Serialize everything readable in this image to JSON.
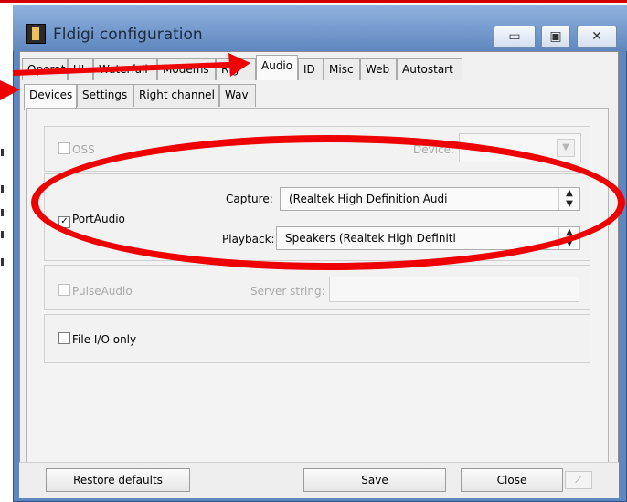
{
  "window": {
    "title": "Fldigi configuration",
    "controls": {
      "minimize": "▭",
      "maximize": "▣",
      "close": "✕"
    }
  },
  "tabs_top": [
    {
      "label": "Operator"
    },
    {
      "label": "UI"
    },
    {
      "label": "Waterfall"
    },
    {
      "label": "Modems"
    },
    {
      "label": "Rig"
    },
    {
      "label": "Audio",
      "active": true
    },
    {
      "label": "ID"
    },
    {
      "label": "Misc"
    },
    {
      "label": "Web"
    },
    {
      "label": "Autostart"
    }
  ],
  "tabs_sub": [
    {
      "label": "Devices",
      "active": true
    },
    {
      "label": "Settings"
    },
    {
      "label": "Right channel"
    },
    {
      "label": "Wav"
    }
  ],
  "oss": {
    "label": "OSS",
    "device_label": "Device:",
    "checked": false,
    "enabled": false
  },
  "portaudio": {
    "label": "PortAudio",
    "checked": true,
    "check_glyph": "✓",
    "capture_label": "Capture:",
    "capture_value": "(Realtek High Definition Audi",
    "playback_label": "Playback:",
    "playback_value": "Speakers (Realtek High Definiti",
    "combo_arrow": "▲▼"
  },
  "pulseaudio": {
    "label": "PulseAudio",
    "server_label": "Server string:",
    "server_value": "",
    "checked": false,
    "enabled": false
  },
  "fileio": {
    "label": "File I/O only",
    "checked": false
  },
  "buttons": {
    "restore": "Restore defaults",
    "save": "Save",
    "close": "Close"
  },
  "annotation": {
    "color": "#ee0000"
  }
}
